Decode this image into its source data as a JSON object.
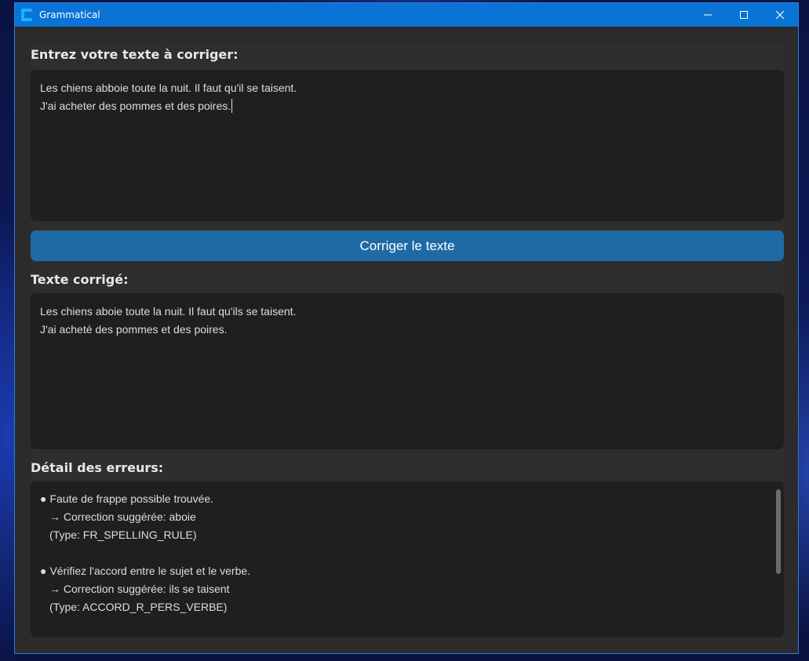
{
  "window": {
    "title": "Grammatical",
    "accent": "#0a74d6"
  },
  "input_section": {
    "label": "Entrez votre texte à corriger:",
    "lines": [
      "Les chiens abboie toute la nuit. Il faut qu'il se taisent.",
      "J'ai acheter des pommes et des poires."
    ]
  },
  "correct_button": {
    "label": "Corriger le texte",
    "color": "#1f6aa5"
  },
  "output_section": {
    "label": "Texte corrigé:",
    "lines": [
      "Les chiens aboie toute la nuit. Il faut qu'ils se taisent.",
      "J'ai acheté des pommes et des poires."
    ]
  },
  "errors_section": {
    "label": "Détail des erreurs:",
    "errors": [
      {
        "bullet": "●",
        "message": "Faute de frappe possible trouvée.",
        "suggestion": "→ Correction suggérée: aboie",
        "type": "(Type: FR_SPELLING_RULE)"
      },
      {
        "bullet": "●",
        "message": "Vérifiez l'accord entre le sujet et le verbe.",
        "suggestion": "→ Correction suggérée: ils se taisent",
        "type": "(Type: ACCORD_R_PERS_VERBE)"
      }
    ]
  },
  "icons": {
    "app": "app-icon",
    "minimize": "minimize-icon",
    "maximize": "maximize-icon",
    "close": "close-icon"
  }
}
